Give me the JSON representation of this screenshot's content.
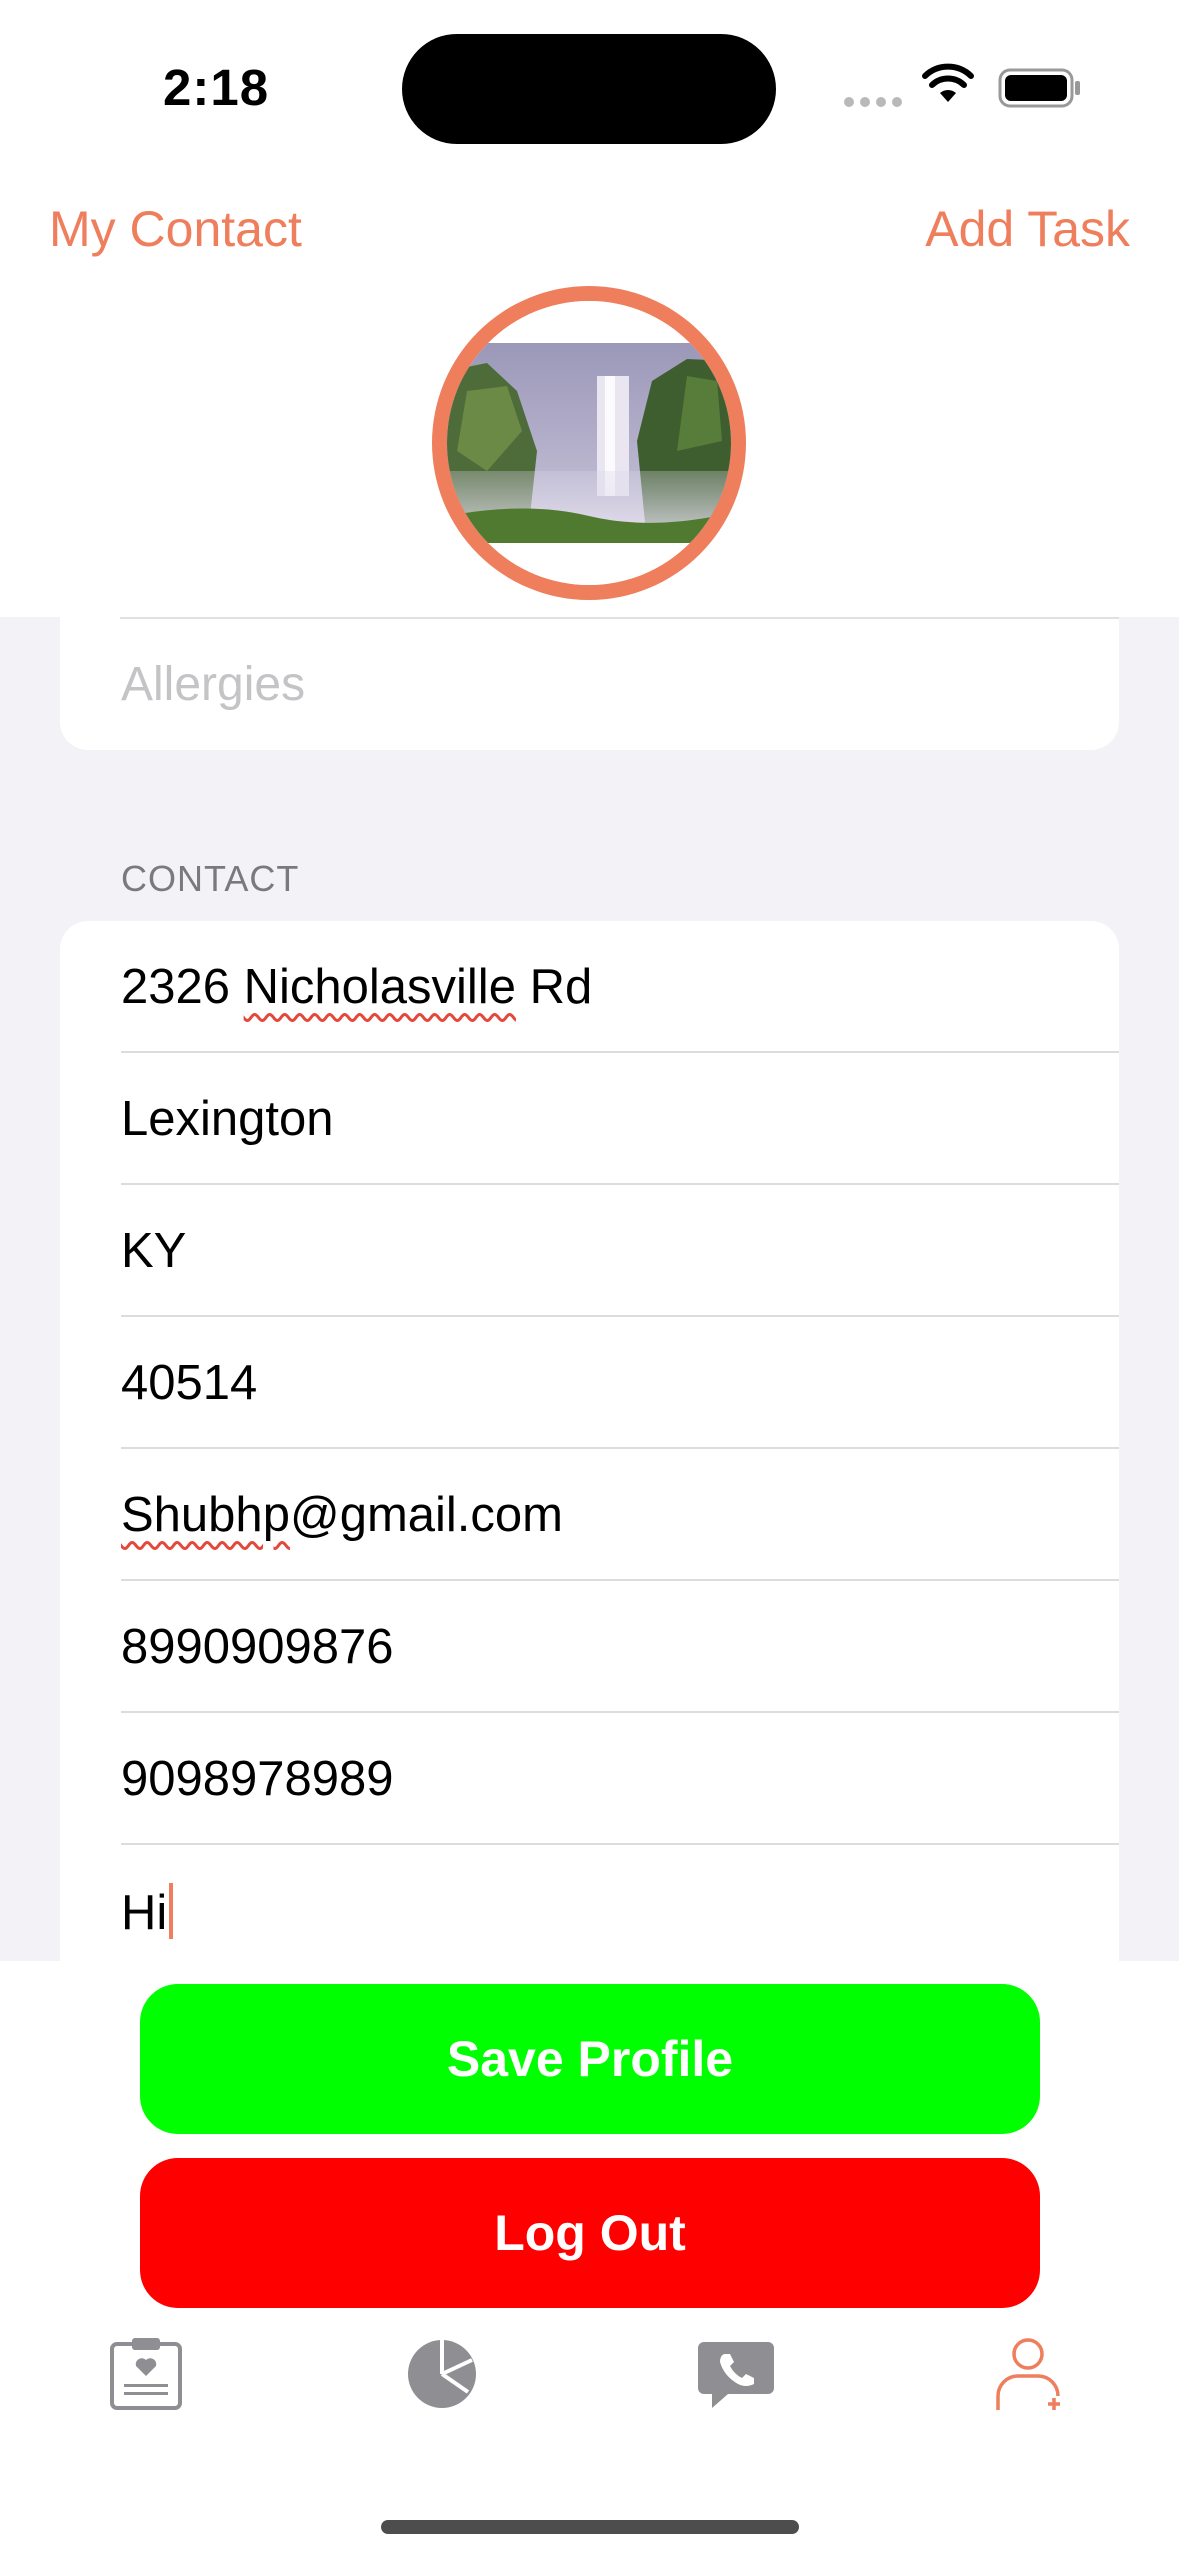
{
  "status_bar": {
    "time": "2:18"
  },
  "nav": {
    "left": "My Contact",
    "right": "Add Task"
  },
  "colors": {
    "accent": "#EE7E5C",
    "save": "#00FF00",
    "logout": "#FF0000",
    "background": "#F2F2F7"
  },
  "profile": {
    "avatar_image": "waterfall-photo"
  },
  "health": {
    "allergies_placeholder": "Allergies"
  },
  "contact": {
    "header": "CONTACT",
    "fields": [
      {
        "value": "2326 Nicholasville Rd"
      },
      {
        "value": "Lexington"
      },
      {
        "value": "KY"
      },
      {
        "value": "40514"
      },
      {
        "value": "Shubhp@gmail.com"
      },
      {
        "value": "8990909876"
      },
      {
        "value": "9098978989"
      },
      {
        "value": "Hi"
      }
    ]
  },
  "buttons": {
    "save": "Save Profile",
    "logout": "Log Out"
  },
  "tabs": [
    {
      "icon": "clipboard-heart-icon"
    },
    {
      "icon": "pie-chart-icon"
    },
    {
      "icon": "phone-bubble-icon"
    },
    {
      "icon": "person-add-icon",
      "selected": true
    }
  ]
}
